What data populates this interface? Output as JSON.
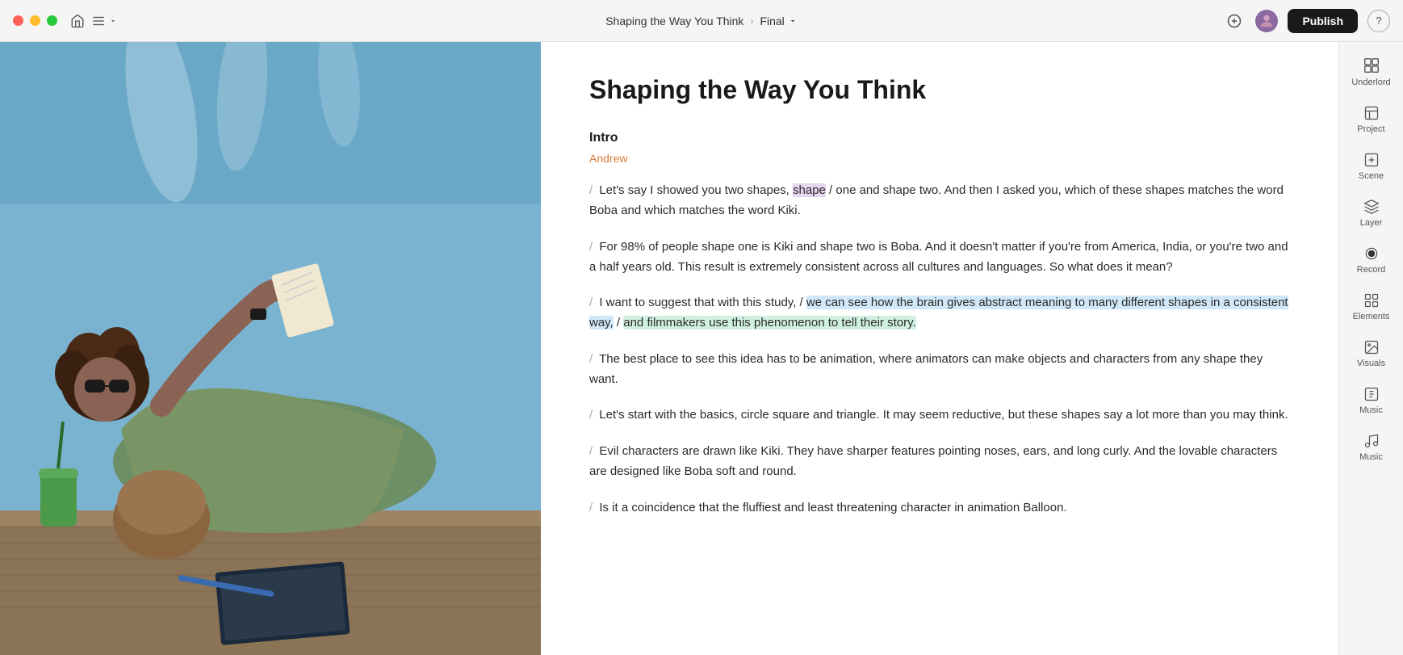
{
  "titlebar": {
    "breadcrumb": "Shaping the Way You Think",
    "branch": "Final",
    "publish_label": "Publish",
    "help_icon": "?"
  },
  "sidebar": {
    "items": [
      {
        "id": "underlord",
        "label": "Underlord",
        "icon": "⊞"
      },
      {
        "id": "project",
        "label": "Project",
        "icon": "📁"
      },
      {
        "id": "scene",
        "label": "Scene",
        "icon": "⬜"
      },
      {
        "id": "layer",
        "label": "Layer",
        "icon": "◫"
      },
      {
        "id": "record",
        "label": "Record",
        "icon": "record"
      },
      {
        "id": "elements",
        "label": "Elements",
        "icon": "⊟"
      },
      {
        "id": "visuals",
        "label": "Visuals",
        "icon": "🖼"
      },
      {
        "id": "music1",
        "label": "Music",
        "icon": "🎵"
      },
      {
        "id": "music2",
        "label": "Music",
        "icon": "🎵"
      }
    ]
  },
  "document": {
    "title": "Shaping the Way You Think",
    "section_label": "Intro",
    "author": "Andrew",
    "paragraphs": [
      {
        "id": 1,
        "text": "Let's say I showed you two shapes, shape one and shape two. And then I asked you, which of these shapes matches the word Boba and which matches the word Kiki."
      },
      {
        "id": 2,
        "text": "For 98% of people shape one is Kiki and shape two is Boba. And it doesn't matter if you're from America, India, or you're two and a half years old. This result is extremely consistent across all cultures and languages. So what does it mean?"
      },
      {
        "id": 3,
        "text": "I want to suggest that with this study, we can see how the brain gives abstract meaning to many different shapes in a consistent way, and filmmakers use this phenomenon to tell their story."
      },
      {
        "id": 4,
        "text": "The best place to see this idea has to be animation, where animators can make objects and characters from any shape they want."
      },
      {
        "id": 5,
        "text": "Let's start with the basics, circle square and triangle. It may seem reductive, but these shapes say a lot more than you may think."
      },
      {
        "id": 6,
        "text": "Evil characters are drawn like Kiki. They have sharper features pointing noses, ears, and long curly. And the lovable characters are designed like Boba soft and round."
      },
      {
        "id": 7,
        "text": "Is it a coincidence that the fluffiest and least threatening character in animation Balloon."
      }
    ]
  }
}
